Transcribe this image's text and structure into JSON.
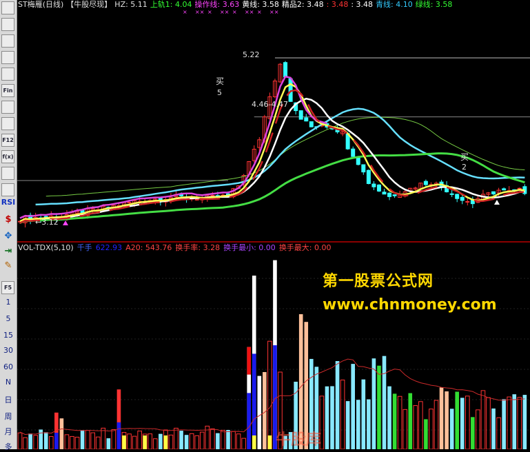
{
  "header": {
    "stock": "ST梅雁(日线)",
    "tag": "【牛股尽现】",
    "items": [
      {
        "label": "HZ: 5.11",
        "color": "#e0e0e0"
      },
      {
        "label": "上轨1: 4.04",
        "color": "#33ff33"
      },
      {
        "label": "操作线: 3.63",
        "color": "#ff44ff"
      },
      {
        "label": "黄线: 3.58",
        "color": "#ffffff"
      },
      {
        "label": "精品2: 3.48",
        "color": "#ffffff"
      },
      {
        "label": ": 3.48",
        "color": "#ff3333"
      },
      {
        "label": ": 3.48",
        "color": "#ffffff"
      },
      {
        "label": "青线: 4.10",
        "color": "#33ccff"
      },
      {
        "label": "绿线: 3.58",
        "color": "#33ff33"
      }
    ]
  },
  "volume_header": {
    "title": "VOL-TDX(5,10)",
    "items": [
      {
        "label": "千手",
        "color": "#4466ff"
      },
      {
        "label": "622.93",
        "color": "#2222ff"
      },
      {
        "label": "A20: 543.76",
        "color": "#ff4444"
      },
      {
        "label": "换手率: 3.28",
        "color": "#ff4444"
      },
      {
        "label": "换手最小: 0.00",
        "color": "#aa44ff"
      },
      {
        "label": "换手最大: 0.00",
        "color": "#ff4444"
      }
    ]
  },
  "toolbar": {
    "icons": [
      "list-icon",
      "grid-icon",
      "line-chart-icon",
      "trend-icon",
      "window-icon",
      "fin-icon",
      "report-icon",
      "document-icon",
      "f12-icon",
      "fx-icon",
      "zoom-icon",
      "wave-icon"
    ],
    "icon_labels": [
      "",
      "",
      "",
      "",
      "",
      "Fin",
      "",
      "",
      "F12",
      "f(x)",
      "",
      ""
    ],
    "rsi": "RSI",
    "f5": "F5",
    "periods": [
      "1",
      "5",
      "15",
      "30",
      "60",
      "N",
      "日",
      "周",
      "月",
      "多"
    ]
  },
  "annotations": {
    "high_price": "5.22",
    "low_price": "←3.12",
    "range_label": "4.46-4.47",
    "buy1": "买",
    "buy1_num": "5",
    "buy2": "买",
    "buy2_num": "2"
  },
  "watermark": {
    "line1": "第一股票公式网",
    "line2": "www.chnmoney.com",
    "line3": "牛股库"
  },
  "colors": {
    "up": "#ff3333",
    "down": "#33ffff",
    "cyan_line": "#66e0ff",
    "green_line": "#44dd44",
    "magenta_line": "#dd44dd",
    "yellow_line": "#ffff55",
    "white_line": "#ffffff",
    "red_line": "#cc2222"
  }
}
